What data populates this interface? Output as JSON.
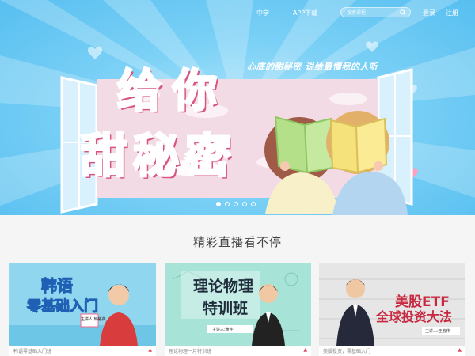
{
  "nav": {
    "link_zx": "中学",
    "link_app": "APP下载",
    "search_placeholder": "搜索课程",
    "login": "登录",
    "register": "注册"
  },
  "banner": {
    "slogan": "心底的甜秘密    说给最懂我的人听",
    "title_line1": "给你",
    "title_line2": "甜秘密",
    "slide_count": 5,
    "active_slide": 1
  },
  "section": {
    "title": "精彩直播看不停"
  },
  "cards": [
    {
      "thumb_title_1": "韩语",
      "thumb_title_2": "零基础入门",
      "thumb_tag": "主讲人:韩郁英",
      "thumb_bg": "#8fd6ee",
      "caption": "韩语零基础入门班",
      "live_mark": "▲"
    },
    {
      "thumb_title_1": "理论物理",
      "thumb_title_2": "特训班",
      "thumb_tag": "主讲人:黄宇",
      "thumb_bg": "#a8e3d8",
      "caption": "理论物理一月特训班",
      "live_mark": "▲"
    },
    {
      "thumb_title_1": "美股ETF",
      "thumb_title_2": "全球投资大法",
      "thumb_tag": "主讲人:王宏伟",
      "thumb_bg": "#e8e8e8",
      "caption": "美股投资，零基础入门",
      "live_mark": "▲"
    }
  ],
  "colors": {
    "accent_pink": "#f46fa3",
    "banner_blue": "#57bff0",
    "live_red": "#e0455f"
  }
}
